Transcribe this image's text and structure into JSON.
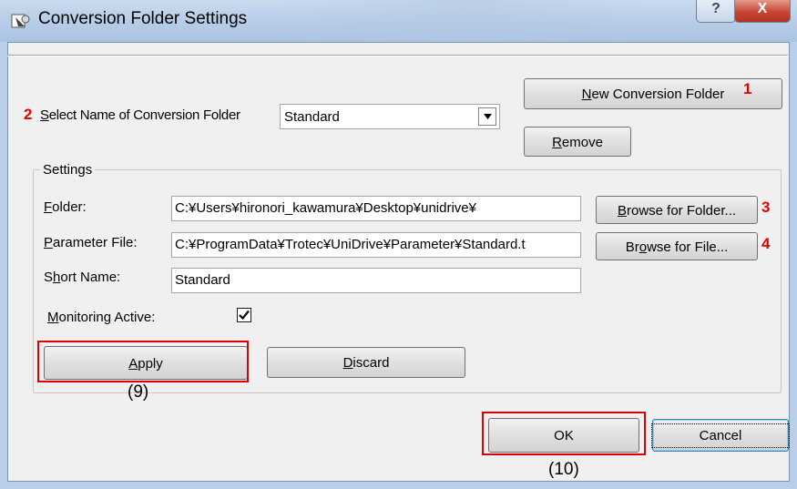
{
  "window": {
    "title": "Conversion Folder Settings",
    "help_glyph": "?",
    "close_glyph": "X"
  },
  "conversion_folder": {
    "label_prefix": "S",
    "label_rest": "elect Name of Conversion Folder",
    "selected": "Standard",
    "new_button_prefix": "N",
    "new_button_rest": "ew Conversion Folder",
    "remove_button_prefix": "R",
    "remove_button_rest": "emove"
  },
  "settings": {
    "group_title": "Settings",
    "folder_label_prefix": "F",
    "folder_label_rest": "older:",
    "folder_value": "C:¥Users¥hironori_kawamura¥Desktop¥unidrive¥",
    "browse_folder_prefix": "B",
    "browse_folder_rest": "rowse for Folder...",
    "param_label_prefix": "P",
    "param_label_rest": "arameter File:",
    "param_value": "C:¥ProgramData¥Trotec¥UniDrive¥Parameter¥Standard.t",
    "browse_file_pre": "Br",
    "browse_file_u": "o",
    "browse_file_rest": "wse for File...",
    "short_label_prefix": "S",
    "short_label_mid": "h",
    "short_label_rest": "ort Name:",
    "short_value": "Standard",
    "monitoring_label_prefix": "M",
    "monitoring_label_rest": "onitoring Active:",
    "monitoring_checked": true,
    "apply_prefix": "A",
    "apply_rest": "pply",
    "discard_prefix": "D",
    "discard_rest": "iscard"
  },
  "footer": {
    "ok_label": "OK",
    "cancel_label": "Cancel"
  },
  "annotations": {
    "n1": "1",
    "n2": "2",
    "n3": "3",
    "n4": "4",
    "n9": "(9)",
    "n10": "(10)",
    "color": "#e00000"
  }
}
